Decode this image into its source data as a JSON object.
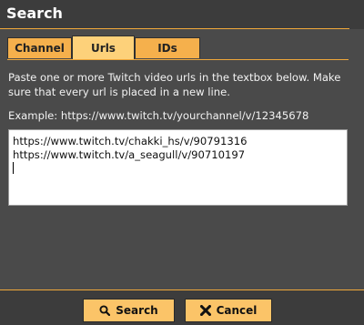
{
  "dialog": {
    "title": "Search"
  },
  "tabs": [
    {
      "label": "Channel",
      "active": false
    },
    {
      "label": "Urls",
      "active": true
    },
    {
      "label": "IDs",
      "active": false
    }
  ],
  "urls_panel": {
    "description": "Paste one or more Twitch video urls in the textbox below. Make sure that every url is placed in a new line.",
    "example": "Example: https://www.twitch.tv/yourchannel/v/12345678",
    "textbox_lines": [
      "https://www.twitch.tv/chakki_hs/v/90791316",
      "https://www.twitch.tv/a_seagull/v/90710197"
    ]
  },
  "buttons": {
    "search": {
      "label": "Search",
      "icon": "search-icon"
    },
    "cancel": {
      "label": "Cancel",
      "icon": "close-icon"
    }
  },
  "colors": {
    "background": "#4a4a4a",
    "accent": "#f0a83a",
    "tab": "#f5b04c",
    "tab_active": "#fdd17a",
    "button": "#fbc468"
  }
}
